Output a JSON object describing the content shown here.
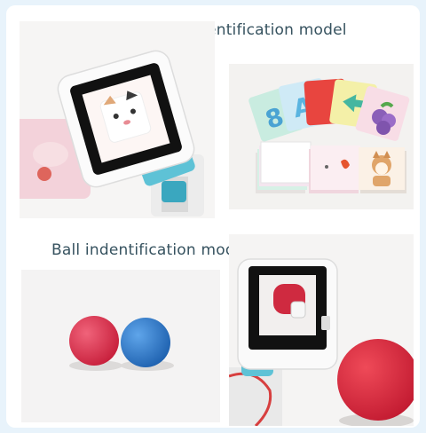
{
  "headings": {
    "card": "Card indentification model",
    "ball": "Ball indentification model"
  },
  "colors": {
    "page_background": "#e8f3fb",
    "panel": "#ffffff",
    "heading_text": "#36525f",
    "device_cyan": "#5ec2d6",
    "ball_red": "#e0344f",
    "ball_blue": "#2f7fcf"
  }
}
